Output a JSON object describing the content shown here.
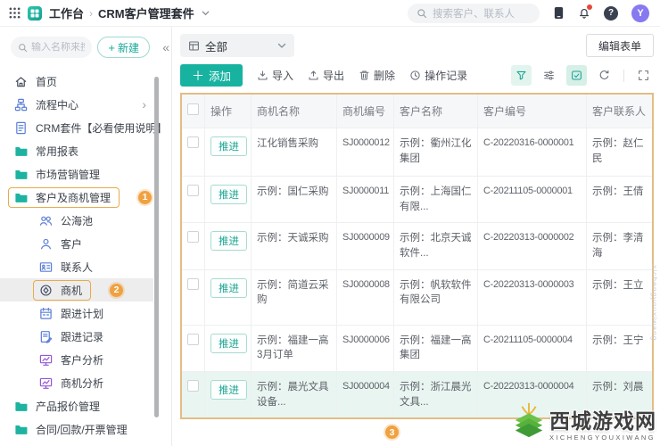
{
  "topbar": {
    "workbench": "工作台",
    "title": "CRM客户管理套件",
    "search_placeholder": "搜索客户、联系人",
    "help_mark": "?",
    "avatar_letter": "Y"
  },
  "sidebar": {
    "search_placeholder": "输入名称来搜索",
    "new_label": "新建",
    "collapse_glyph": "«",
    "items": [
      {
        "label": "首页",
        "icon": "home-icon",
        "level": 1
      },
      {
        "label": "流程中心",
        "icon": "flow-icon",
        "level": 1,
        "chevron": true
      },
      {
        "label": "CRM套件【必看使用说明】",
        "icon": "doc-icon",
        "level": 1
      },
      {
        "label": "常用报表",
        "icon": "folder-icon",
        "level": 1
      },
      {
        "label": "市场营销管理",
        "icon": "folder-icon",
        "level": 1
      },
      {
        "label": "客户及商机管理",
        "icon": "folder-icon",
        "level": 1,
        "highlight": true,
        "badge": "1"
      },
      {
        "label": "公海池",
        "icon": "users-icon",
        "level": 2
      },
      {
        "label": "客户",
        "icon": "user-icon",
        "level": 2
      },
      {
        "label": "联系人",
        "icon": "contact-card-icon",
        "level": 2
      },
      {
        "label": "商机",
        "icon": "opportunity-icon",
        "level": 2,
        "highlight": true,
        "badge": "2",
        "selected": true
      },
      {
        "label": "跟进计划",
        "icon": "calendar-icon",
        "level": 2
      },
      {
        "label": "跟进记录",
        "icon": "record-icon",
        "level": 2
      },
      {
        "label": "客户分析",
        "icon": "analysis-icon",
        "level": 2
      },
      {
        "label": "商机分析",
        "icon": "analysis-icon",
        "level": 2
      },
      {
        "label": "产品报价管理",
        "icon": "folder-icon",
        "level": 1
      },
      {
        "label": "合同/回款/开票管理",
        "icon": "folder-icon",
        "level": 1
      }
    ]
  },
  "main": {
    "view_filter": "全部",
    "edit_form_label": "编辑表单",
    "toolbar": {
      "add": "添加",
      "import": "导入",
      "export": "导出",
      "delete": "删除",
      "log": "操作记录"
    },
    "table": {
      "action_label": "推进",
      "headers": [
        "操作",
        "商机名称",
        "商机编号",
        "客户名称",
        "客户编号",
        "客户联系人"
      ],
      "rows": [
        {
          "name": "江化销售采购",
          "sn": "SJ0000012",
          "customer": "示例：衢州江化集团",
          "code": "C-20220316-0000001",
          "contact": "示例：赵仁民"
        },
        {
          "name": "示例：国仁采购",
          "sn": "SJ0000011",
          "customer": "示例：上海国仁有限...",
          "code": "C-20211105-0000001",
          "contact": "示例：王倩"
        },
        {
          "name": "示例：天诚采购",
          "sn": "SJ0000009",
          "customer": "示例：北京天诚软件...",
          "code": "C-20220313-0000002",
          "contact": "示例：李清海"
        },
        {
          "name": "示例：简道云采购",
          "sn": "SJ0000008",
          "customer": "示例：帆软软件有限公司",
          "code": "C-20220313-0000003",
          "contact": "示例：王立"
        },
        {
          "name": "示例：福建一高3月订单",
          "sn": "SJ0000006",
          "customer": "示例：福建一高集团",
          "code": "C-20211105-0000004",
          "contact": "示例：王宁"
        },
        {
          "name": "示例：晨光文具设备...",
          "sn": "SJ0000004",
          "customer": "示例：浙江晨光文具...",
          "code": "C-20220313-0000004",
          "contact": "示例：刘晨",
          "highlighted": true
        }
      ]
    }
  },
  "annotations": {
    "step1": "1",
    "step2": "2",
    "step3": "3"
  },
  "watermark": {
    "name": "西城游戏网",
    "latin": "XICHENGYOUXIWANG",
    "vertical": "xichengyouxiwang"
  },
  "colors": {
    "accent": "#17b3a0",
    "annotation": "#f0a141",
    "table_border": "#e3bd85",
    "selected_row": "#e9f5f1"
  }
}
